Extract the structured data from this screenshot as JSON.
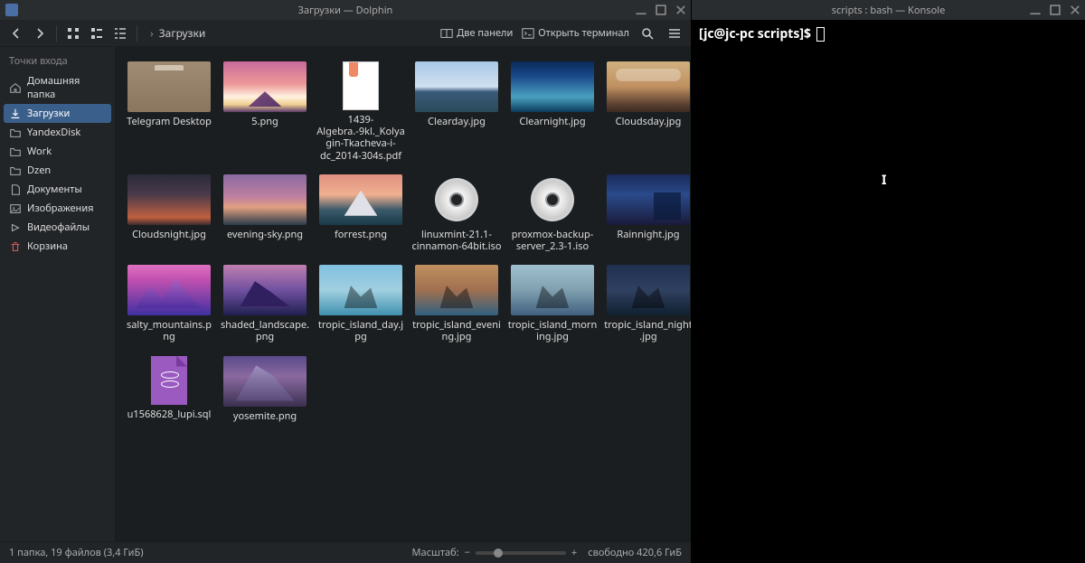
{
  "dolphin": {
    "title": "Загрузки — Dolphin",
    "breadcrumb": "Загрузки",
    "toolbar_right": {
      "split": "Две панели",
      "terminal": "Открыть терминал"
    },
    "sidebar": {
      "header": "Точки входа",
      "items": [
        {
          "label": "Домашняя папка",
          "icon": "home"
        },
        {
          "label": "Загрузки",
          "icon": "download",
          "selected": true
        },
        {
          "label": "YandexDisk",
          "icon": "folder"
        },
        {
          "label": "Work",
          "icon": "folder"
        },
        {
          "label": "Dzen",
          "icon": "folder"
        },
        {
          "label": "Документы",
          "icon": "document"
        },
        {
          "label": "Изображения",
          "icon": "image"
        },
        {
          "label": "Видеофайлы",
          "icon": "video"
        },
        {
          "label": "Корзина",
          "icon": "trash"
        }
      ]
    },
    "files": [
      {
        "name": "Telegram Desktop",
        "type": "folder"
      },
      {
        "name": "5.png",
        "type": "5png"
      },
      {
        "name": "1439-Algebra.-9kl._Kolyagin-Tkacheva-i-dc_2014-304s.pdf",
        "type": "pdf"
      },
      {
        "name": "Clearday.jpg",
        "type": "clearday"
      },
      {
        "name": "Clearnight.jpg",
        "type": "clearnight"
      },
      {
        "name": "Cloudsday.jpg",
        "type": "cloudsday"
      },
      {
        "name": "Cloudsnight.jpg",
        "type": "cloudsnight"
      },
      {
        "name": "evening-sky.png",
        "type": "evesky"
      },
      {
        "name": "forrest.png",
        "type": "forrest"
      },
      {
        "name": "linuxmint-21.1-cinnamon-64bit.iso",
        "type": "disc"
      },
      {
        "name": "proxmox-backup-server_2.3-1.iso",
        "type": "disc"
      },
      {
        "name": "Rainnight.jpg",
        "type": "rainnight"
      },
      {
        "name": "salty_mountains.png",
        "type": "salty"
      },
      {
        "name": "shaded_landscape.png",
        "type": "shaded"
      },
      {
        "name": "tropic_island_day.jpg",
        "type": "tropic-day"
      },
      {
        "name": "tropic_island_evening.jpg",
        "type": "tropic-eve"
      },
      {
        "name": "tropic_island_morning.jpg",
        "type": "tropic-morn"
      },
      {
        "name": "tropic_island_night.jpg",
        "type": "tropic-night"
      },
      {
        "name": "u1568628_lupi.sql",
        "type": "sql"
      },
      {
        "name": "yosemite.png",
        "type": "yosemite"
      }
    ],
    "status": {
      "summary": "1 папка, 19 файлов (3,4 ГиБ)",
      "zoom_label": "Масштаб:",
      "free": "свободно 420,6 ГиБ"
    }
  },
  "konsole": {
    "title": "scripts : bash — Konsole",
    "prompt": "[jc@jc-pc scripts]$ "
  }
}
